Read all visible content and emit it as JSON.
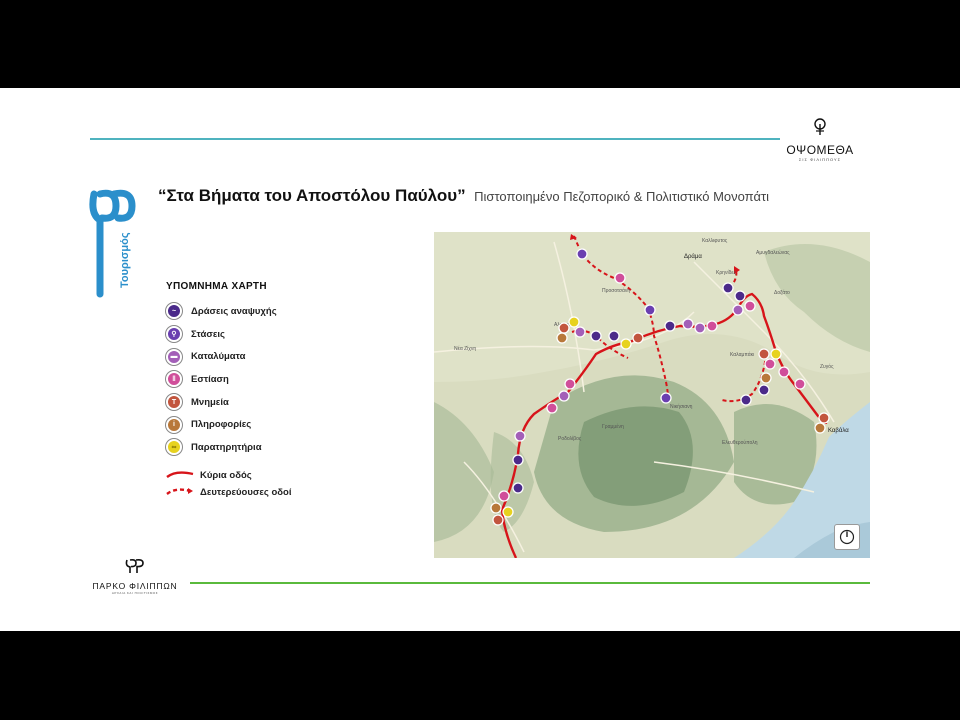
{
  "title": {
    "main": "“Στα Βήματα του Αποστόλου Παύλου”",
    "sub": "Πιστοποιημένο Πεζοπορικό & Πολιτιστικό Μονοπάτι"
  },
  "side_logo": {
    "word": "Τουρισμός"
  },
  "brand": {
    "name": "ΟΨΟΜΕΘΑ",
    "sub": "ΣΙΣ ΦΙΛΙΠΠΟΥΣ"
  },
  "park": {
    "name": "ΠΑΡΚΟ ΦΙΛΙΠΠΩΝ",
    "sub": "ΑΡΧΑΙΑ ΚΑΙ ΠΟΛΙΤΙΣΜΟΣ"
  },
  "legend": {
    "title": "ΥΠΟΜΝΗΜΑ ΧΑΡΤΗ",
    "items": [
      {
        "label": "Δράσεις αναψυχής",
        "color": "#4b2a8a",
        "icon": "leisure-icon"
      },
      {
        "label": "Στάσεις",
        "color": "#6a3fb0",
        "icon": "stop-icon"
      },
      {
        "label": "Καταλύματα",
        "color": "#a35fb8",
        "icon": "bed-icon"
      },
      {
        "label": "Εστίαση",
        "color": "#d04e9a",
        "icon": "cutlery-icon"
      },
      {
        "label": "Μνημεία",
        "color": "#c2553e",
        "icon": "column-icon"
      },
      {
        "label": "Πληροφορίες",
        "color": "#b8783a",
        "icon": "info-icon"
      },
      {
        "label": "Παρατηρητήρια",
        "color": "#e7d21f",
        "icon": "binoculars-icon"
      }
    ],
    "main_road": "Κύρια οδός",
    "secondary_road": "Δευτερεύουσες οδοί",
    "road_color": "#d7141a"
  },
  "map": {
    "labels": {
      "drama": "Δράμα",
      "kavala": "Καβάλα",
      "kalamonas": "Καλλιφυτος",
      "krinides": "Κρηνίδες",
      "eleftheroupoli": "Ελευθερούπολη",
      "rodolivos": "Ροδολίβος",
      "nikisiani": "Νικήσιανη",
      "alistrati": "Αλιστράτη",
      "prosotsani": "Προσοτσάνη",
      "ampelofyto": "Αμυγδαλεώνας",
      "grammeni": "Γραμμένη",
      "kalampaki": "Καλαμπάκι",
      "doxato": "Δοξάτο",
      "zygos": "Ζυγός",
      "nea_zichni": "Νέα Ζίχνη"
    }
  }
}
